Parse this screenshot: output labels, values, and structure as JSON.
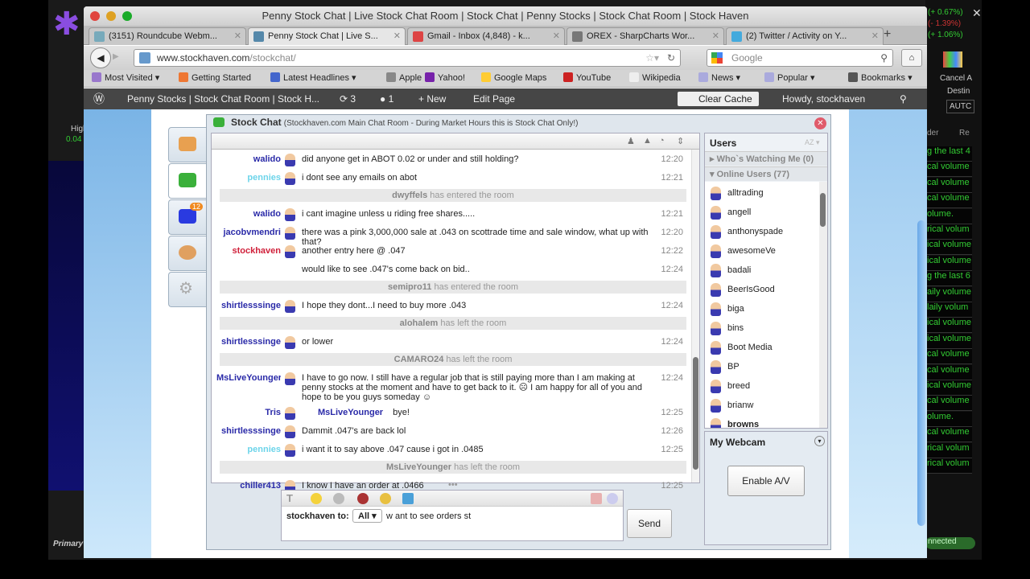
{
  "window_title": "Penny Stock Chat | Live Stock Chat Room | Stock Chat | Penny Stocks | Stock Chat Room | Stock Haven",
  "tabs": [
    {
      "label": "(3151) Roundcube Webm...",
      "color": "#7ab"
    },
    {
      "label": "Penny Stock Chat | Live S...",
      "color": "#58a",
      "active": true
    },
    {
      "label": "Gmail - Inbox (4,848) - k...",
      "color": "#d44"
    },
    {
      "label": "OREX - SharpCharts Wor...",
      "color": "#777"
    },
    {
      "label": "(2) Twitter / Activity on Y...",
      "color": "#4ad"
    }
  ],
  "url": {
    "domain": "www.stockhaven.com",
    "path": "/stockchat/"
  },
  "search_placeholder": "Google",
  "bookmarks": [
    "Most Visited ▾",
    "Getting Started",
    "Latest Headlines ▾",
    "Apple",
    "Yahoo!",
    "Google Maps",
    "YouTube",
    "Wikipedia",
    "News ▾",
    "Popular ▾",
    "Bookmarks ▾"
  ],
  "wpbar": {
    "site": "Penny Stocks | Stock Chat Room | Stock H...",
    "updates": "3",
    "comments": "1",
    "new": "New",
    "edit": "Edit Page",
    "clear_cache": "Clear Cache",
    "howdy": "Howdy, stockhaven"
  },
  "chat": {
    "title": "Stock Chat",
    "subtitle": "(Stockhaven.com Main Chat Room - During Market Hours this is Stock Chat Only!)",
    "badge": "12",
    "messages": [
      {
        "user": "walido",
        "color": "#2a2aa8",
        "text": "did anyone get in ABOT 0.02 or under and still holding?",
        "time": "12:20"
      },
      {
        "user": "pennies",
        "color": "#6cd4ea",
        "text": "i dont see any emails on abot",
        "time": "12:21"
      },
      {
        "system": true,
        "user": "dwyffels",
        "text": "has entered the room"
      },
      {
        "user": "walido",
        "color": "#2a2aa8",
        "text": "i cant imagine unless u riding free shares.....",
        "time": "12:21"
      },
      {
        "user": "jacobvmendri",
        "color": "#2a2aa8",
        "text": "there was a pink 3,000,000 sale at .043 on scottrade time and sale window, what up with that?",
        "time": "12:20"
      },
      {
        "user": "stockhaven",
        "color": "#d0203a",
        "text": "another entry here @ .047",
        "time": "12:22"
      },
      {
        "user": "",
        "color": "#000",
        "text": "would like to see .047's come back on bid..",
        "time": "12:24"
      },
      {
        "system": true,
        "user": "semipro11",
        "text": "has entered the room"
      },
      {
        "user": "shirtlesssinge",
        "color": "#2a2aa8",
        "text": "I hope they dont...I need to buy more .043",
        "time": "12:24"
      },
      {
        "system": true,
        "user": "alohalem",
        "text": "has left the room"
      },
      {
        "user": "shirtlesssinge",
        "color": "#2a2aa8",
        "text": "or lower",
        "time": "12:24"
      },
      {
        "system": true,
        "user": "CAMARO24",
        "text": "has left the room"
      },
      {
        "user": "MsLiveYounger",
        "color": "#2a2aa8",
        "text": "I have to go now. I still have a regular job that is still paying more than I am making at penny stocks at the moment and have to get back to it. ☹ I am happy for all of you and hope to be you guys someday ☺",
        "time": "12:24",
        "tall": true
      },
      {
        "user": "Tris",
        "color": "#2a2aa8",
        "mention": "MsLiveYounger",
        "text": "bye!",
        "time": "12:25"
      },
      {
        "user": "shirtlesssinge",
        "color": "#2a2aa8",
        "text": "Dammit .047's are back lol",
        "time": "12:26"
      },
      {
        "user": "pennies",
        "color": "#6cd4ea",
        "text": "i want it to say above .047 cause i got in .0485",
        "time": "12:25"
      },
      {
        "system": true,
        "user": "MsLiveYounger",
        "text": "has left the room"
      },
      {
        "user": "chiller413",
        "color": "#2a2aa8",
        "text": "I know I have an order at .0466",
        "time": "12:25"
      }
    ],
    "composer": {
      "from_label": "stockhaven to:",
      "recipient": "All",
      "value": "w ant to see orders st",
      "send": "Send"
    }
  },
  "users": {
    "title": "Users",
    "sort_icon": "AZ",
    "watching": "Who`s Watching Me (0)",
    "online": "Online Users (77)",
    "list": [
      "alltrading",
      "angell",
      "anthonyspade",
      "awesomeVe",
      "badali",
      "BeerIsGood",
      "biga",
      "bins",
      "Boot Media",
      "BP",
      "breed",
      "brianw",
      "browns"
    ]
  },
  "webcam": {
    "title": "My Webcam",
    "enable": "Enable A/V"
  },
  "background_app": {
    "tickers": [
      "(+ 0.67%)",
      "(- 1.39%)",
      "(+ 1.06%)"
    ],
    "cancel": "Cancel A",
    "dest": "Destin",
    "auto": "AUTC",
    "high": "High",
    "high_val": "0.04",
    "primary": "Primary",
    "connected": "nnected",
    "ro": "der",
    "re": "Re",
    "volume_lines": [
      "g the last 4",
      "cal volume",
      "cal volume",
      "cal volume",
      "olume.",
      "rical volum",
      "ical volume",
      "ical volume",
      "g the last 6",
      "aily volume",
      "laily volum",
      "ical volume",
      "ical volume",
      "cal volume",
      "cal volume",
      "ical volume",
      "cal volume",
      "olume.",
      "cal volume",
      "rical volum",
      "rical volum"
    ]
  }
}
